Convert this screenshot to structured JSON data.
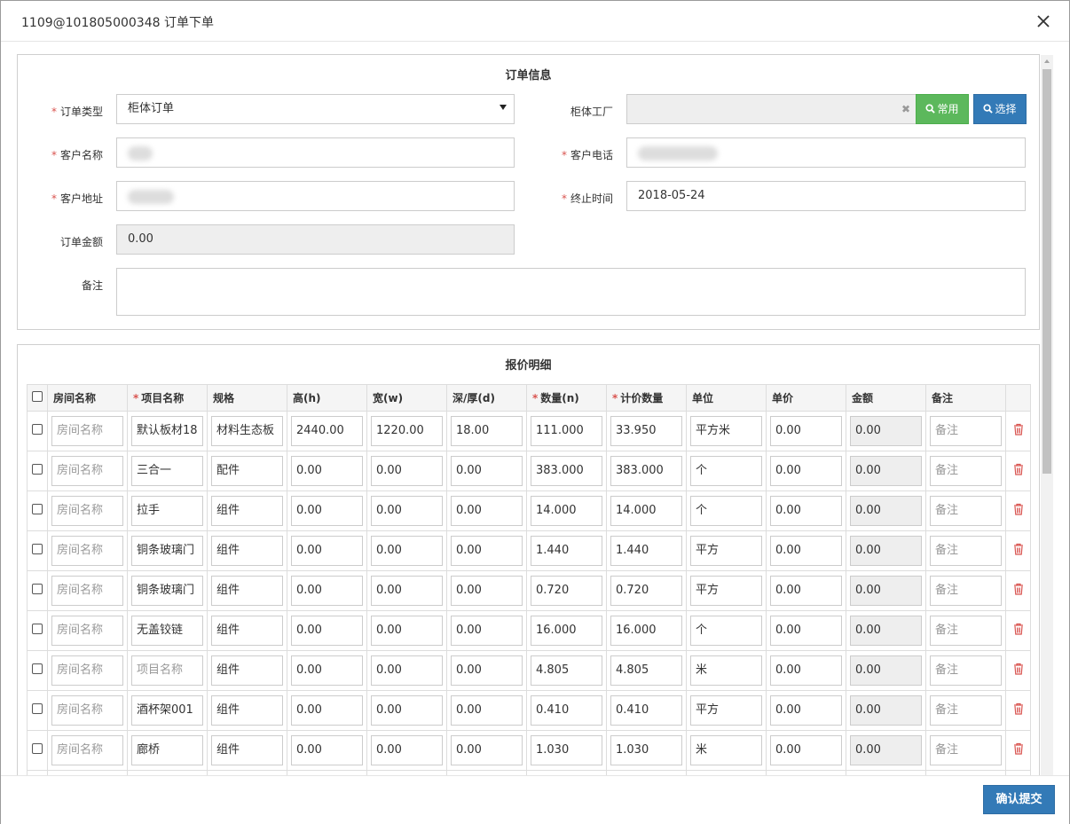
{
  "dialog": {
    "title": "1109@101805000348 订单下单",
    "confirm_label": "确认提交"
  },
  "order_info": {
    "section_title": "订单信息",
    "order_type": {
      "label": "订单类型",
      "value": "柜体订单"
    },
    "factory": {
      "label": "柜体工厂",
      "value": "",
      "common_label": "常用",
      "select_label": "选择"
    },
    "customer_name": {
      "label": "客户名称"
    },
    "customer_phone": {
      "label": "客户电话"
    },
    "customer_address": {
      "label": "客户地址"
    },
    "deadline": {
      "label": "终止时间",
      "value": "2018-05-24"
    },
    "amount": {
      "label": "订单金额",
      "value": "0.00"
    },
    "remark": {
      "label": "备注",
      "value": ""
    }
  },
  "quote": {
    "section_title": "报价明细",
    "columns": [
      "房间名称",
      "项目名称",
      "规格",
      "高(h)",
      "宽(w)",
      "深/厚(d)",
      "数量(n)",
      "计价数量",
      "单位",
      "单价",
      "金额",
      "备注"
    ],
    "required_columns": [
      1,
      6,
      7
    ],
    "placeholders": {
      "room": "房间名称",
      "item": "项目名称",
      "remark": "备注"
    },
    "rows": [
      {
        "room": "",
        "item": "默认板材18",
        "spec": "材料生态板",
        "h": "2440.00",
        "w": "1220.00",
        "d": "18.00",
        "qty": "111.000",
        "priced_qty": "33.950",
        "unit": "平方米",
        "price": "0.00",
        "amount": "0.00",
        "remark": ""
      },
      {
        "room": "",
        "item": "三合一",
        "spec": "配件",
        "h": "0.00",
        "w": "0.00",
        "d": "0.00",
        "qty": "383.000",
        "priced_qty": "383.000",
        "unit": "个",
        "price": "0.00",
        "amount": "0.00",
        "remark": ""
      },
      {
        "room": "",
        "item": "拉手",
        "spec": "组件",
        "h": "0.00",
        "w": "0.00",
        "d": "0.00",
        "qty": "14.000",
        "priced_qty": "14.000",
        "unit": "个",
        "price": "0.00",
        "amount": "0.00",
        "remark": ""
      },
      {
        "room": "",
        "item": "铜条玻璃门",
        "spec": "组件",
        "h": "0.00",
        "w": "0.00",
        "d": "0.00",
        "qty": "1.440",
        "priced_qty": "1.440",
        "unit": "平方",
        "price": "0.00",
        "amount": "0.00",
        "remark": ""
      },
      {
        "room": "",
        "item": "铜条玻璃门",
        "spec": "组件",
        "h": "0.00",
        "w": "0.00",
        "d": "0.00",
        "qty": "0.720",
        "priced_qty": "0.720",
        "unit": "平方",
        "price": "0.00",
        "amount": "0.00",
        "remark": ""
      },
      {
        "room": "",
        "item": "无盖铰链",
        "spec": "组件",
        "h": "0.00",
        "w": "0.00",
        "d": "0.00",
        "qty": "16.000",
        "priced_qty": "16.000",
        "unit": "个",
        "price": "0.00",
        "amount": "0.00",
        "remark": ""
      },
      {
        "room": "",
        "item": "",
        "spec": "组件",
        "h": "0.00",
        "w": "0.00",
        "d": "0.00",
        "qty": "4.805",
        "priced_qty": "4.805",
        "unit": "米",
        "price": "0.00",
        "amount": "0.00",
        "remark": ""
      },
      {
        "room": "",
        "item": "酒杯架001",
        "spec": "组件",
        "h": "0.00",
        "w": "0.00",
        "d": "0.00",
        "qty": "0.410",
        "priced_qty": "0.410",
        "unit": "平方",
        "price": "0.00",
        "amount": "0.00",
        "remark": ""
      },
      {
        "room": "",
        "item": "廊桥",
        "spec": "组件",
        "h": "0.00",
        "w": "0.00",
        "d": "0.00",
        "qty": "1.030",
        "priced_qty": "1.030",
        "unit": "米",
        "price": "0.00",
        "amount": "0.00",
        "remark": ""
      },
      {
        "room": "",
        "item": "",
        "spec": "",
        "h": "",
        "w": "",
        "d": "",
        "qty": "",
        "priced_qty": "",
        "unit": "",
        "price": "",
        "amount": "",
        "remark": ""
      }
    ]
  },
  "colors": {
    "required": "#d9534f",
    "btn_green": "#5cb85c",
    "btn_blue": "#337ab7",
    "delete_icon": "#d9534f"
  },
  "icons": {
    "close": "close-icon",
    "search": "search-icon",
    "delete": "trash-icon",
    "clear": "clear-icon"
  }
}
